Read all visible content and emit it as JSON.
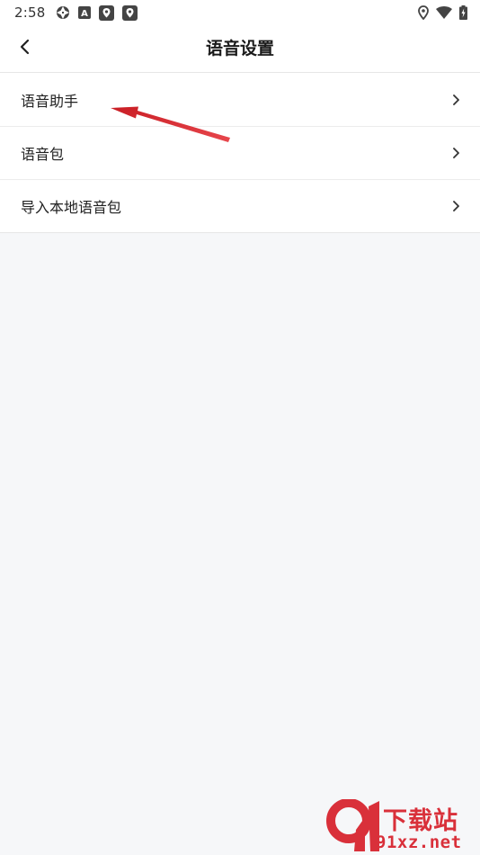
{
  "status_bar": {
    "time": "2:58",
    "left_icons": [
      "aperture-icon",
      "a-box-icon",
      "map-pin-box-icon",
      "map-pin-box-icon"
    ],
    "right_icons": [
      "location-icon",
      "wifi-icon",
      "battery-charging-icon"
    ]
  },
  "header": {
    "title": "语音设置",
    "back_icon": "chevron-left-icon"
  },
  "settings": {
    "items": [
      {
        "label": "语音助手"
      },
      {
        "label": "语音包"
      },
      {
        "label": "导入本地语音包"
      }
    ],
    "chevron_icon": "chevron-right-icon"
  },
  "annotation": {
    "color": "#d9242b"
  },
  "watermark": {
    "logo_text": "9",
    "top_text": "下载站",
    "bottom_text": "91xz.net",
    "color": "#d9303a"
  },
  "colors": {
    "background": "#f6f7f9",
    "surface": "#ffffff",
    "divider": "#e6e6e6",
    "text_primary": "#222222"
  }
}
